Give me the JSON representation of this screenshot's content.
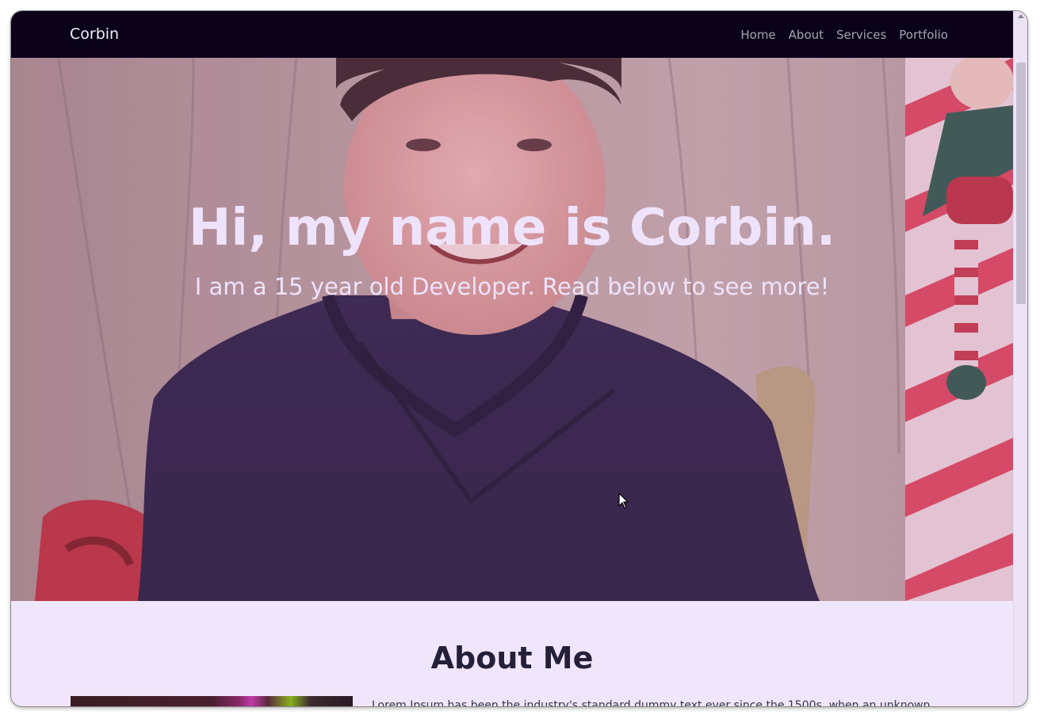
{
  "navbar": {
    "brand": "Corbin",
    "links": [
      "Home",
      "About",
      "Services",
      "Portfolio"
    ]
  },
  "hero": {
    "title": "Hi, my name is Corbin.",
    "subtitle": "I am a 15 year old Developer. Read below to see more!"
  },
  "about": {
    "title": "About Me",
    "text": "Lorem Ipsum has been the industry's standard dummy text ever since the 1500s, when an unknown"
  },
  "colors": {
    "navbar_bg": "#0b0219",
    "page_bg": "#f0e6fb",
    "hero_text": "#efe3fb",
    "heading_text": "#24203a"
  }
}
